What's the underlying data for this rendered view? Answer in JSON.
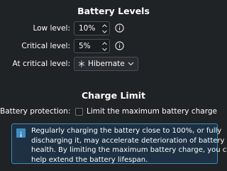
{
  "battery_levels": {
    "heading": "Battery Levels",
    "low_label": "Low level:",
    "low_value": "10%",
    "critical_label": "Critical level:",
    "critical_value": "5%",
    "action_label": "At critical level:",
    "action_value": "Hibernate"
  },
  "charge_limit": {
    "heading": "Charge Limit",
    "protection_label": "Battery protection:",
    "checkbox_label": "Limit the maximum battery charge",
    "checkbox_checked": false,
    "message_line1": "Regularly charging the battery close to 100%, or fully",
    "message_line2": "discharging it, may accelerate deterioration of battery",
    "message_line3": "health. By limiting the maximum battery charge, you can",
    "message_line4": "help extend the battery lifespan."
  },
  "colors": {
    "background": "#202326",
    "info_accent": "#3d8dbd",
    "info_background": "#1d3143"
  },
  "icons": {
    "info": "info-icon",
    "hibernate": "snowflake-icon",
    "combo": "chevron-down-icon",
    "spin_up": "chevron-up-icon",
    "spin_down": "chevron-down-icon"
  }
}
